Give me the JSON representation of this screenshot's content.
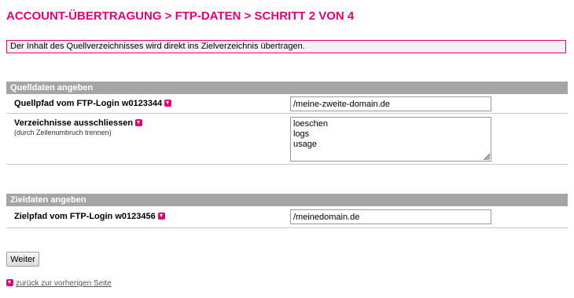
{
  "page": {
    "title": "ACCOUNT-ÜBERTRAGUNG > FTP-DATEN > SCHRITT 2 VON 4",
    "notice": "Der Inhalt des Quellverzeichnisses wird direkt ins Zielverzeichnis übertragen."
  },
  "source_section": {
    "header": "Quelldaten angeben",
    "path_label": "Quellpfad vom FTP-Login w0123344",
    "path_value": "/meine-zweite-domain.de",
    "exclude_label": "Verzeichnisse ausschliessen",
    "exclude_hint": "(durch Zeilenumbruch trennen)",
    "exclude_value": "loeschen\nlogs\nusage"
  },
  "target_section": {
    "header": "Zieldaten angeben",
    "path_label": "Zielpfad vom FTP-Login w0123456",
    "path_value": "/meinedomain.de"
  },
  "actions": {
    "next_label": "Weiter",
    "back_label": "zurück zur vorherigen Seite"
  },
  "colors": {
    "accent": "#e20074",
    "section_header_bg": "#a5a5a5"
  },
  "icons": {
    "help": "help-icon",
    "back": "back-arrow-icon"
  }
}
